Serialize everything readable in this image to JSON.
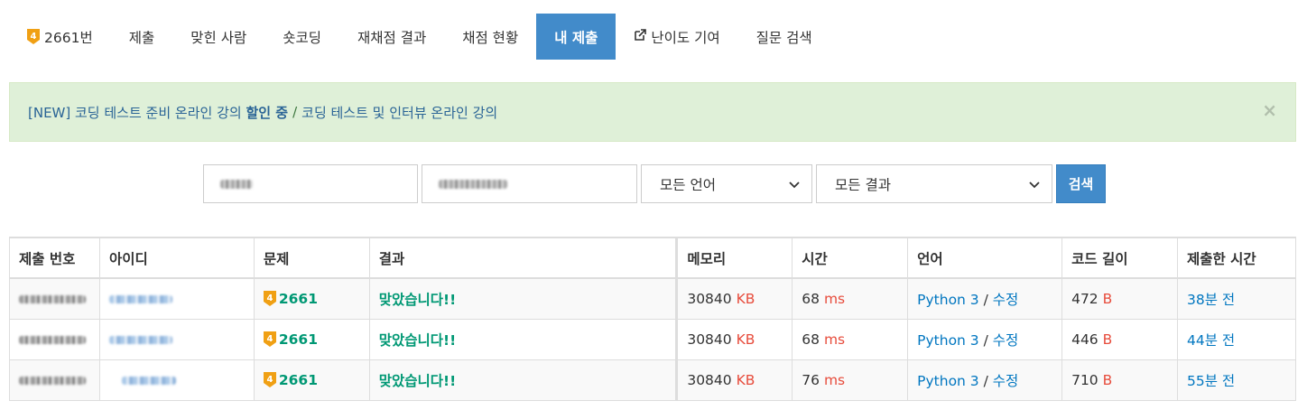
{
  "nav": {
    "problem_tab": "2661번",
    "tier_number": "4",
    "tabs": [
      {
        "label": "제출"
      },
      {
        "label": "맞힌 사람"
      },
      {
        "label": "숏코딩"
      },
      {
        "label": "재채점 결과"
      },
      {
        "label": "채점 현황"
      },
      {
        "label": "내 제출"
      },
      {
        "label": "난이도 기여"
      },
      {
        "label": "질문 검색"
      }
    ],
    "active_tab": "내 제출"
  },
  "alert": {
    "part1": "[NEW] 코딩 테스트 준비 온라인 강의 ",
    "part1_bold": "할인 중",
    "separator": "/",
    "part2": "코딩 테스트 및 인터뷰 온라인 강의",
    "close": "×"
  },
  "search": {
    "language_select": "모든 언어",
    "result_select": "모든 결과",
    "button": "검색"
  },
  "table": {
    "headers": [
      "제출 번호",
      "아이디",
      "문제",
      "결과",
      "메모리",
      "시간",
      "언어",
      "코드 길이",
      "제출한 시간"
    ],
    "rows": [
      {
        "problem": "2661",
        "result": "맞았습니다!!",
        "memory": "30840",
        "memory_unit": "KB",
        "time": "68",
        "time_unit": "ms",
        "lang": "Python 3",
        "edit": "수정",
        "code_len": "472",
        "code_unit": "B",
        "submitted": "38분 전"
      },
      {
        "problem": "2661",
        "result": "맞았습니다!!",
        "memory": "30840",
        "memory_unit": "KB",
        "time": "68",
        "time_unit": "ms",
        "lang": "Python 3",
        "edit": "수정",
        "code_len": "446",
        "code_unit": "B",
        "submitted": "44분 전"
      },
      {
        "problem": "2661",
        "result": "맞았습니다!!",
        "memory": "30840",
        "memory_unit": "KB",
        "time": "76",
        "time_unit": "ms",
        "lang": "Python 3",
        "edit": "수정",
        "code_len": "710",
        "code_unit": "B",
        "submitted": "55분 전"
      }
    ]
  },
  "colors": {
    "primary": "#428bca",
    "accepted": "#009874",
    "unit": "#e74c3c",
    "link": "#0076c0",
    "tier_gold": "#f0a014",
    "alert_bg": "#dff0d8"
  },
  "icons": {
    "tier": "tier-gold-4-icon",
    "external": "external-link-icon",
    "close": "close-icon",
    "chevron": "chevron-down-icon"
  }
}
